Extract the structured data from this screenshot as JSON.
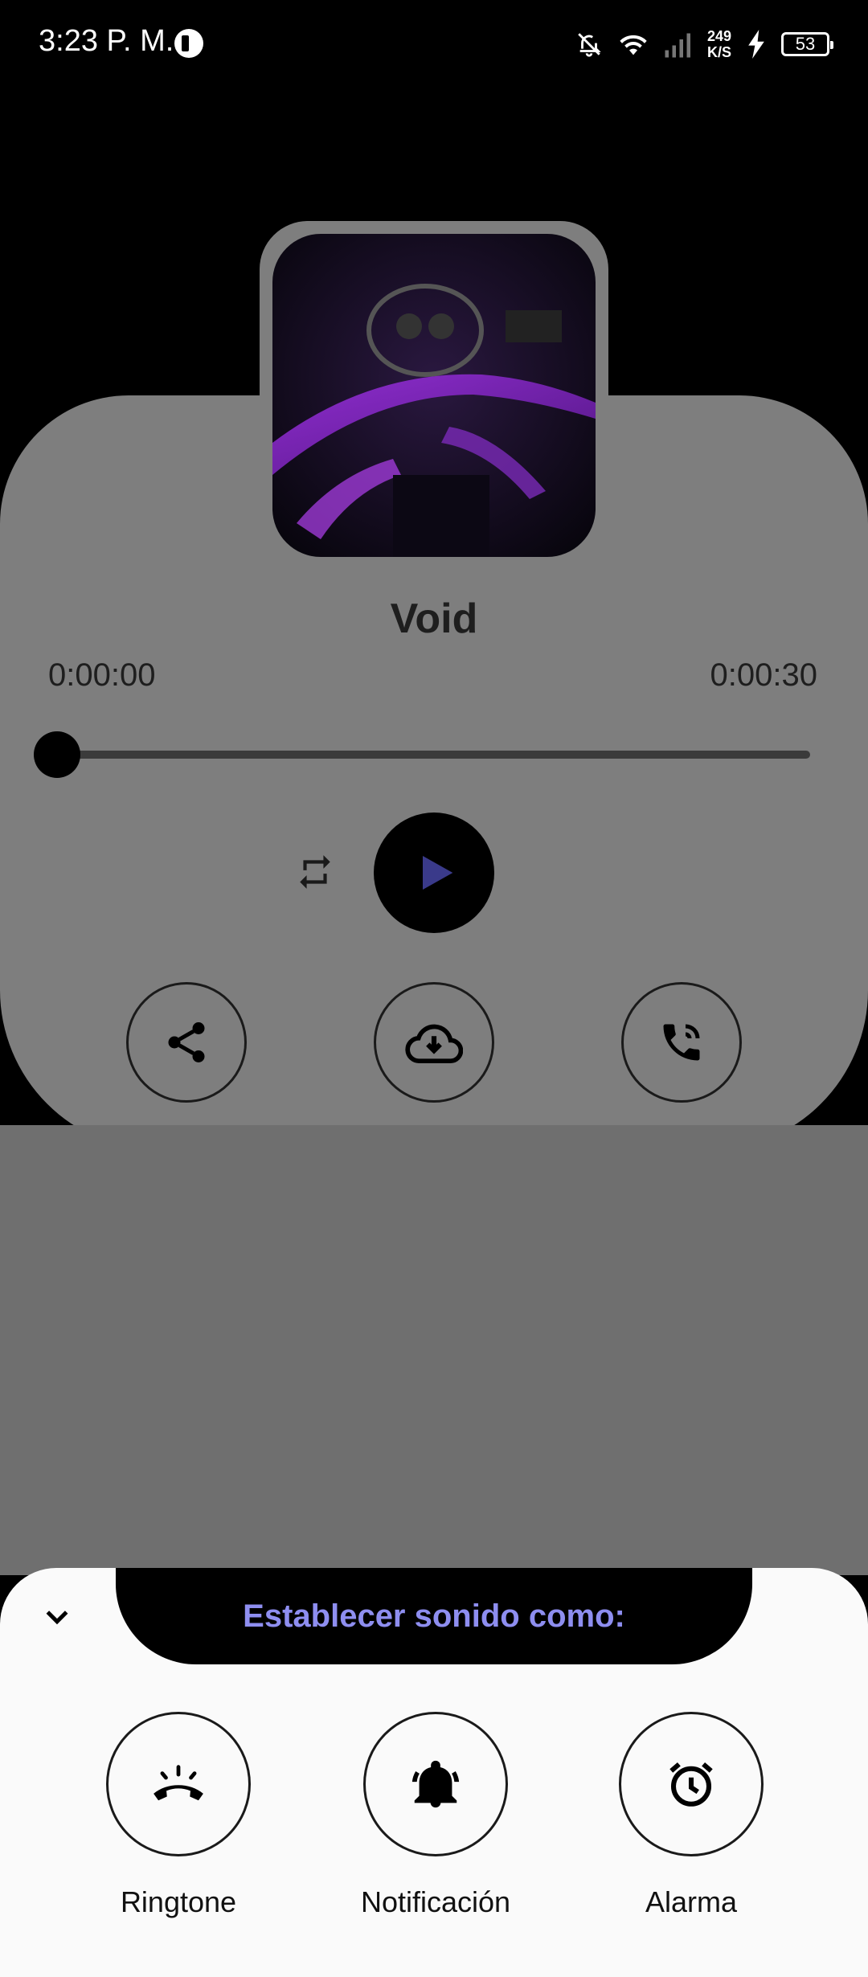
{
  "status_bar": {
    "time": "3:23 P. M.",
    "net_speed_value": "249",
    "net_speed_unit": "K/S",
    "battery": "53"
  },
  "player": {
    "title": "Void",
    "time_current": "0:00:00",
    "time_total": "0:00:30",
    "progress": 0
  },
  "sheet": {
    "title": "Establecer sonido como:",
    "options": [
      {
        "label": "Ringtone",
        "icon": "phone-ringing-icon"
      },
      {
        "label": "Notificación",
        "icon": "bell-ringing-icon"
      },
      {
        "label": "Alarma",
        "icon": "alarm-clock-icon"
      }
    ]
  },
  "colors": {
    "accent": "#8e8ef0",
    "play_icon": "#3a3a8a",
    "card": "#7e7e7e",
    "sheet": "#fafafa"
  }
}
